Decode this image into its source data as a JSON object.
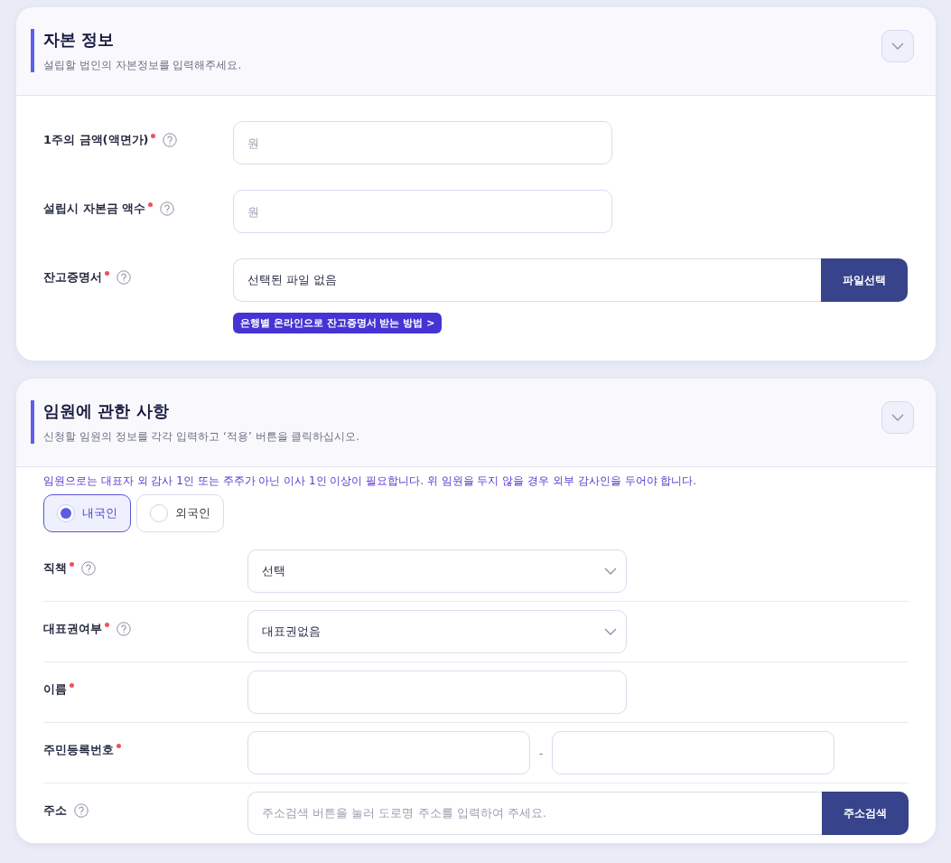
{
  "sections": [
    {
      "title": "자본 정보",
      "subtitle": "설립할 법인의 자본정보를 입력해주세요.",
      "fields": [
        {
          "kind": "input",
          "label": "1주의 금액(액면가)",
          "required": true,
          "help": true,
          "placeholder": "원"
        },
        {
          "kind": "input",
          "label": "설립시 자본금 액수",
          "required": true,
          "help": true,
          "placeholder": "원"
        },
        {
          "kind": "file",
          "label": "잔고증명서",
          "required": true,
          "help": true,
          "value": "선택된 파일 없음",
          "button": "파일선택",
          "link": "은행별 온라인으로 잔고증명서 받는 방법 >"
        }
      ]
    },
    {
      "title": "임원에 관한 사항",
      "subtitle": "신청할 임원의 정보를 각각 입력하고 ‘적용’ 버튼을 클릭하십시오.",
      "notice": "임원으로는 대표자 외 감사 1인 또는 주주가 아닌 이사 1인 이상이 필요합니다. 위 임원을 두지 않을 경우 외부 감사인을 두어야 합니다.",
      "radios": [
        {
          "label": "내국인",
          "selected": true
        },
        {
          "label": "외국인",
          "selected": false
        }
      ],
      "fields": [
        {
          "kind": "select",
          "label": "직책",
          "required": true,
          "help": true,
          "value": "선택"
        },
        {
          "kind": "select",
          "label": "대표권여부",
          "required": true,
          "help": true,
          "value": "대표권없음"
        },
        {
          "kind": "input",
          "label": "이름",
          "required": true,
          "help": false
        },
        {
          "kind": "split",
          "label": "주민등록번호",
          "required": true,
          "help": false,
          "separator": "-"
        },
        {
          "kind": "address",
          "label": "주소",
          "required": false,
          "help": true,
          "placeholder": "주소검색 버튼을 눌러 도로명 주소를 입력하여 주세요.",
          "button": "주소검색"
        }
      ]
    }
  ]
}
